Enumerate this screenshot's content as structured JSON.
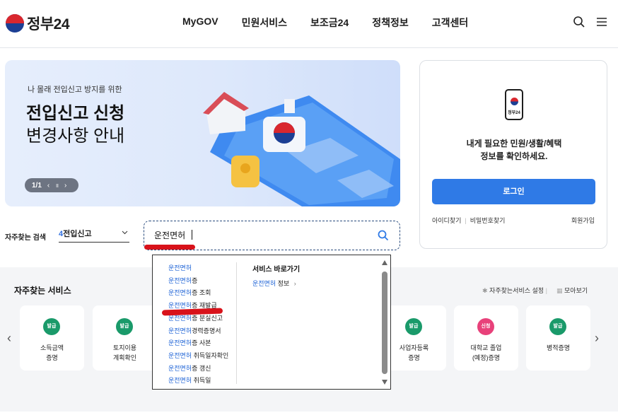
{
  "header": {
    "logo_text": "정부24",
    "nav": [
      "MyGOV",
      "민원서비스",
      "보조금24",
      "정책정보",
      "고객센터"
    ],
    "icons": [
      "search-icon",
      "menu-icon"
    ]
  },
  "hero": {
    "subtitle": "나 몰래 전입신고 방지를 위한",
    "title_line1": "전입신고 신청",
    "title_line2": "변경사항 안내",
    "pager_text": "1/1"
  },
  "login_card": {
    "phone_label": "정부24",
    "message_line1": "내게 필요한 민원/생활/혜택",
    "message_line2": "정보를 확인하세요.",
    "login_button": "로그인",
    "find_id": "아이디찾기",
    "find_password": "비밀번호찾기",
    "join": "회원가입"
  },
  "search": {
    "label": "자주찾는 검색",
    "select_num": "4",
    "select_text": "전입신고",
    "query": "운전면허"
  },
  "dropdown": {
    "highlight": "운전면허",
    "suggestions": [
      {
        "hl": "운전면허",
        "rest": ""
      },
      {
        "hl": "운전면허",
        "rest": "증"
      },
      {
        "hl": "운전면허",
        "rest": "증 조회"
      },
      {
        "hl": "운전면허",
        "rest": "증 재발급"
      },
      {
        "hl": "운전면허",
        "rest": "증 분실신고"
      },
      {
        "hl": "운전면허",
        "rest": "경력증명서"
      },
      {
        "hl": "운전면허",
        "rest": "증 사본"
      },
      {
        "hl": "운전면허",
        "rest": " 취득일자확인"
      },
      {
        "hl": "운전면허",
        "rest": "증 갱신"
      },
      {
        "hl": "운전면허",
        "rest": " 취득일"
      }
    ],
    "quick_title": "서비스 바로가기",
    "quick_link_hl": "운전면허",
    "quick_link_rest": " 정보",
    "quick_link_arrow": "›"
  },
  "frequent": {
    "title": "자주찾는 서비스",
    "settings": "자주찾는서비스 설정",
    "view_all": "모아보기",
    "cards": [
      {
        "badge": "발급",
        "line1": "소득금액",
        "line2": "증명"
      },
      {
        "badge": "발급",
        "line1": "토지이용",
        "line2": "계획확인"
      },
      {
        "badge": "발급",
        "line1": "사업자등록",
        "line2": "증명"
      },
      {
        "badge": "신청",
        "line1": "대학교 졸업",
        "line2": "(예정)증명"
      },
      {
        "badge": "발급",
        "line1": "병적증명",
        "line2": ""
      }
    ]
  },
  "colors": {
    "primary": "#2f7ae6",
    "highlight_text": "#1c62d6",
    "badge_green": "#1a9a6a",
    "badge_pink": "#e8417a",
    "annotation_red": "#d8121a"
  }
}
